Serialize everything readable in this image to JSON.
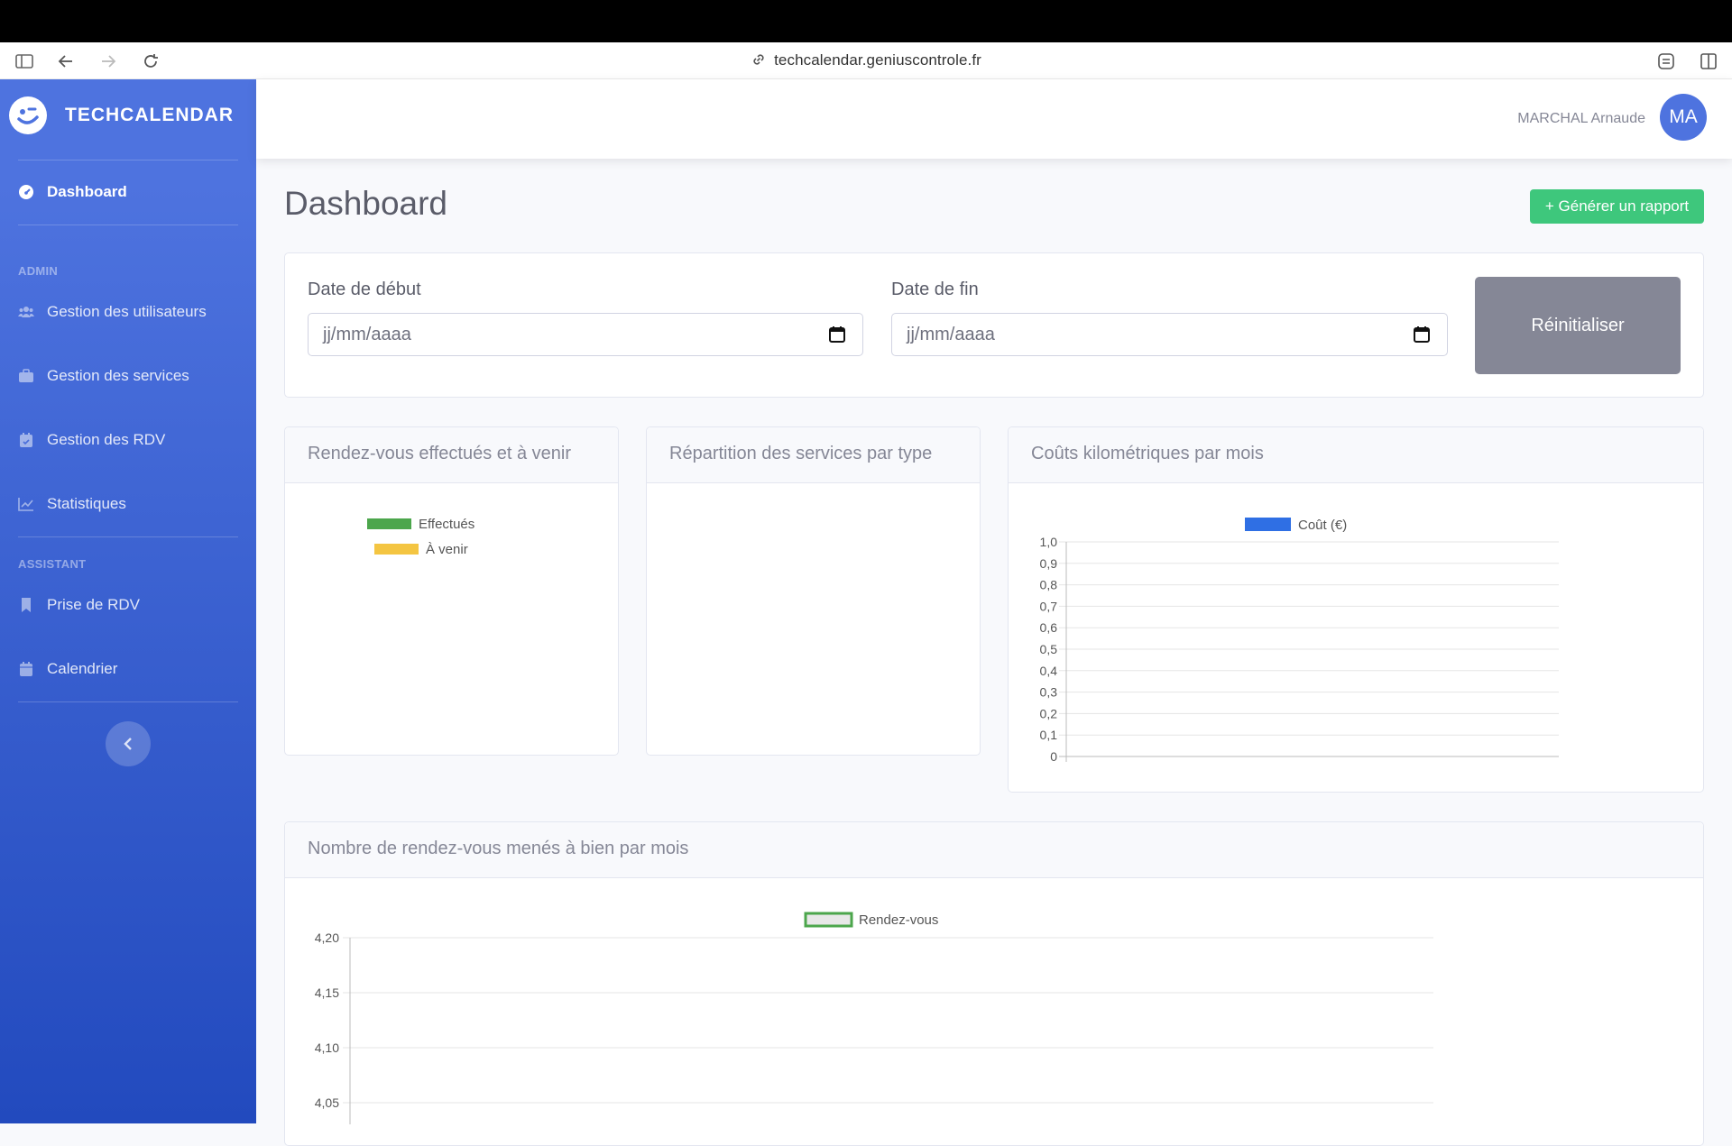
{
  "browser": {
    "url": "techcalendar.geniuscontrole.fr"
  },
  "brand": {
    "name": "TECHCALENDAR"
  },
  "sidebar": {
    "dashboard": "Dashboard",
    "heading_admin": "ADMIN",
    "users": "Gestion des utilisateurs",
    "services": "Gestion des services",
    "rdv": "Gestion des RDV",
    "stats": "Statistiques",
    "heading_assistant": "ASSISTANT",
    "booking": "Prise de RDV",
    "calendar": "Calendrier"
  },
  "topnav": {
    "user_name": "MARCHAL Arnaude",
    "avatar_initials": "MA"
  },
  "page": {
    "title": "Dashboard",
    "report_button": "+ Générer un rapport"
  },
  "filters": {
    "start_label": "Date de début",
    "start_placeholder": "jj/mm/aaaa",
    "end_label": "Date de fin",
    "end_placeholder": "jj/mm/aaaa",
    "reset_button": "Réinitialiser"
  },
  "cards": {
    "rdv_title": "Rendez-vous effectués et à venir",
    "services_title": "Répartition des services par type",
    "costs_title": "Coûts kilométriques par mois",
    "monthly_title": "Nombre de rendez-vous menés à bien par mois"
  },
  "colors": {
    "primary": "#4e73df",
    "success": "#3ec77c",
    "secondary": "#858796"
  },
  "chart_data": [
    {
      "type": "pie",
      "title": "Rendez-vous effectués et à venir",
      "legend": [
        {
          "name": "Effectués",
          "color": "#4ca64c"
        },
        {
          "name": "À venir",
          "color": "#f4c542"
        }
      ],
      "values": []
    },
    {
      "type": "pie",
      "title": "Répartition des services par type",
      "values": []
    },
    {
      "type": "bar",
      "title": "Coûts kilométriques par mois",
      "series": [
        {
          "name": "Coût (€)",
          "color": "#2f6fe4",
          "values": []
        }
      ],
      "yticks": [
        "1,0",
        "0,9",
        "0,8",
        "0,7",
        "0,6",
        "0,5",
        "0,4",
        "0,3",
        "0,2",
        "0,1",
        "0"
      ],
      "ylim": [
        0,
        1
      ],
      "grid": true,
      "legend": "top"
    },
    {
      "type": "line",
      "title": "Nombre de rendez-vous menés à bien par mois",
      "series": [
        {
          "name": "Rendez-vous",
          "color": "#4ca64c",
          "values": []
        }
      ],
      "yticks": [
        "4,20",
        "4,15",
        "4,10",
        "4,05"
      ],
      "grid": true,
      "legend": "top"
    }
  ]
}
